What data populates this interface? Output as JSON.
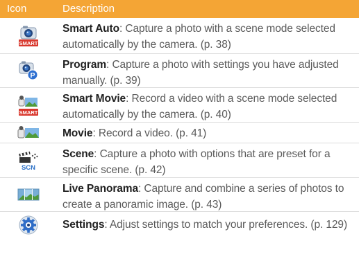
{
  "header": {
    "icon": "Icon",
    "description": "Description"
  },
  "colors": {
    "header_bg": "#f4a535",
    "header_text": "#ffffff",
    "title_text": "#1f1f1f",
    "body_text": "#5a5a5a",
    "row_divider": "#dcdcdc",
    "smart_label_bg": "#d9382e",
    "accent_blue": "#2f6dc7"
  },
  "rows": [
    {
      "icon": "smart-auto-icon",
      "icon_label": "SMART",
      "title": "Smart Auto",
      "text": ": Capture a photo with a scene mode selected automatically by the camera. (p. 38)"
    },
    {
      "icon": "program-icon",
      "icon_label": "P",
      "title": "Program",
      "text": ": Capture a photo with settings you have adjusted manually. (p. 39)"
    },
    {
      "icon": "smart-movie-icon",
      "icon_label": "SMART",
      "title": "Smart Movie",
      "text": ": Record a video with a scene mode selected automatically by the camera. (p. 40)"
    },
    {
      "icon": "movie-icon",
      "title": "Movie",
      "text": ": Record a video. (p. 41)"
    },
    {
      "icon": "scene-icon",
      "icon_label": "SCN",
      "title": "Scene",
      "text": ": Capture a photo with options that are preset for a specific scene. (p. 42)"
    },
    {
      "icon": "live-panorama-icon",
      "title": "Live Panorama",
      "text": ": Capture and combine a series of photos to create a panoramic image. (p. 43)"
    },
    {
      "icon": "settings-icon",
      "title": "Settings",
      "text": ": Adjust settings to match your preferences. (p. 129)"
    }
  ]
}
